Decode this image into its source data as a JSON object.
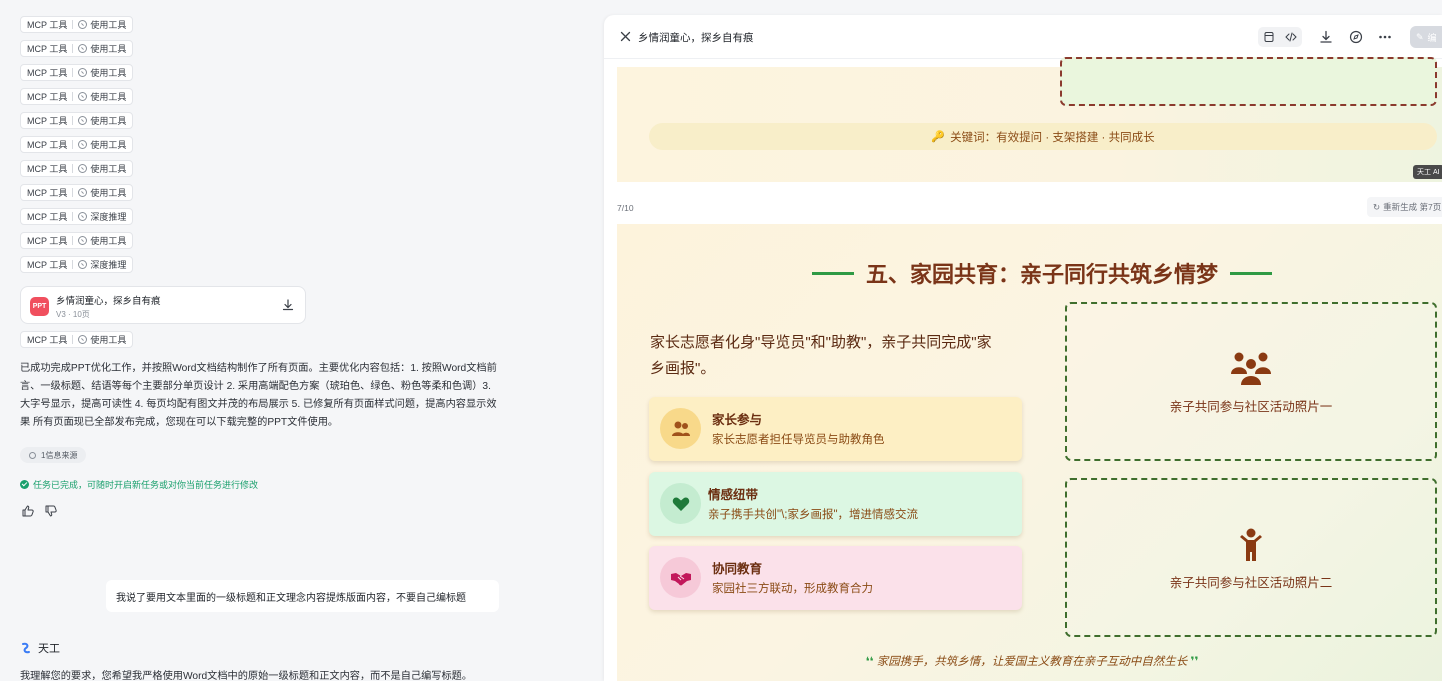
{
  "chat": {
    "tool_calls": [
      {
        "tag": "MCP 工具",
        "action": "使用工具"
      },
      {
        "tag": "MCP 工具",
        "action": "使用工具"
      },
      {
        "tag": "MCP 工具",
        "action": "使用工具"
      },
      {
        "tag": "MCP 工具",
        "action": "使用工具"
      },
      {
        "tag": "MCP 工具",
        "action": "使用工具"
      },
      {
        "tag": "MCP 工具",
        "action": "使用工具"
      },
      {
        "tag": "MCP 工具",
        "action": "使用工具"
      },
      {
        "tag": "MCP 工具",
        "action": "使用工具"
      },
      {
        "tag": "MCP 工具",
        "action": "深度推理"
      },
      {
        "tag": "MCP 工具",
        "action": "使用工具"
      },
      {
        "tag": "MCP 工具",
        "action": "深度推理"
      }
    ],
    "file_card": {
      "badge": "PPT",
      "name": "乡情润童心，探乡自有痕",
      "meta": "V3 · 10页"
    },
    "tool_after": {
      "tag": "MCP 工具",
      "action": "使用工具"
    },
    "summary": "已成功完成PPT优化工作，并按照Word文档结构制作了所有页面。主要优化内容包括：1. 按照Word文档前言、一级标题、结语等每个主要部分单页设计 2. 采用高端配色方案（琥珀色、绿色、粉色等柔和色调）3. 大字号显示，提高可读性 4. 每页均配有图文并茂的布局展示 5. 已修复所有页面样式问题，提高内容显示效果 所有页面现已全部发布完成，您现在可以下载完整的PPT文件使用。",
    "source_chip": "1信息来源",
    "task_done": "任务已完成，可随时开启新任务或对你当前任务进行修改",
    "user_message": "我说了要用文本里面的一级标题和正文理念内容提炼版面内容，不要自己编标题",
    "bot_name": "天工",
    "bot_reply": "我理解您的要求，您希望我严格使用Word文档中的原始一级标题和正文内容，而不是自己编写标题。"
  },
  "preview": {
    "title": "乡情润童心，探乡自有痕",
    "edit_label": "编",
    "prev_slide": {
      "keywords": "关键词：有效提问 · 支架搭建 · 共同成长",
      "watermark": "天工 AI"
    },
    "page_number": "7/10",
    "regen_label": "重新生成 第7页",
    "slide": {
      "title": "五、家园共育：亲子同行共筑乡情梦",
      "intro": "家长志愿者化身\"导览员\"和\"助教\"，亲子共同完成\"家乡画报\"。",
      "cards": [
        {
          "title": "家长参与",
          "desc": "家长志愿者担任导览员与助教角色",
          "icon": "users-icon"
        },
        {
          "title": "情感纽带",
          "desc": "亲子携手共创\"\\;家乡画报\"，增进情感交流",
          "icon": "heart-icon"
        },
        {
          "title": "协同教育",
          "desc": "家园社三方联动，形成教育合力",
          "icon": "handshake-icon"
        }
      ],
      "photos": [
        {
          "label": "亲子共同参与社区活动照片一",
          "icon": "family-icon"
        },
        {
          "label": "亲子共同参与社区活动照片二",
          "icon": "child-icon"
        }
      ],
      "quote": "家园携手，共筑乡情，让爱国主义教育在亲子互动中自然生长"
    },
    "colors": {
      "title": "#7a3418",
      "accent_green": "#2f9a44",
      "card1": "#fdefc4",
      "card2": "#dcf7e3",
      "card3": "#fbe1ea"
    }
  }
}
